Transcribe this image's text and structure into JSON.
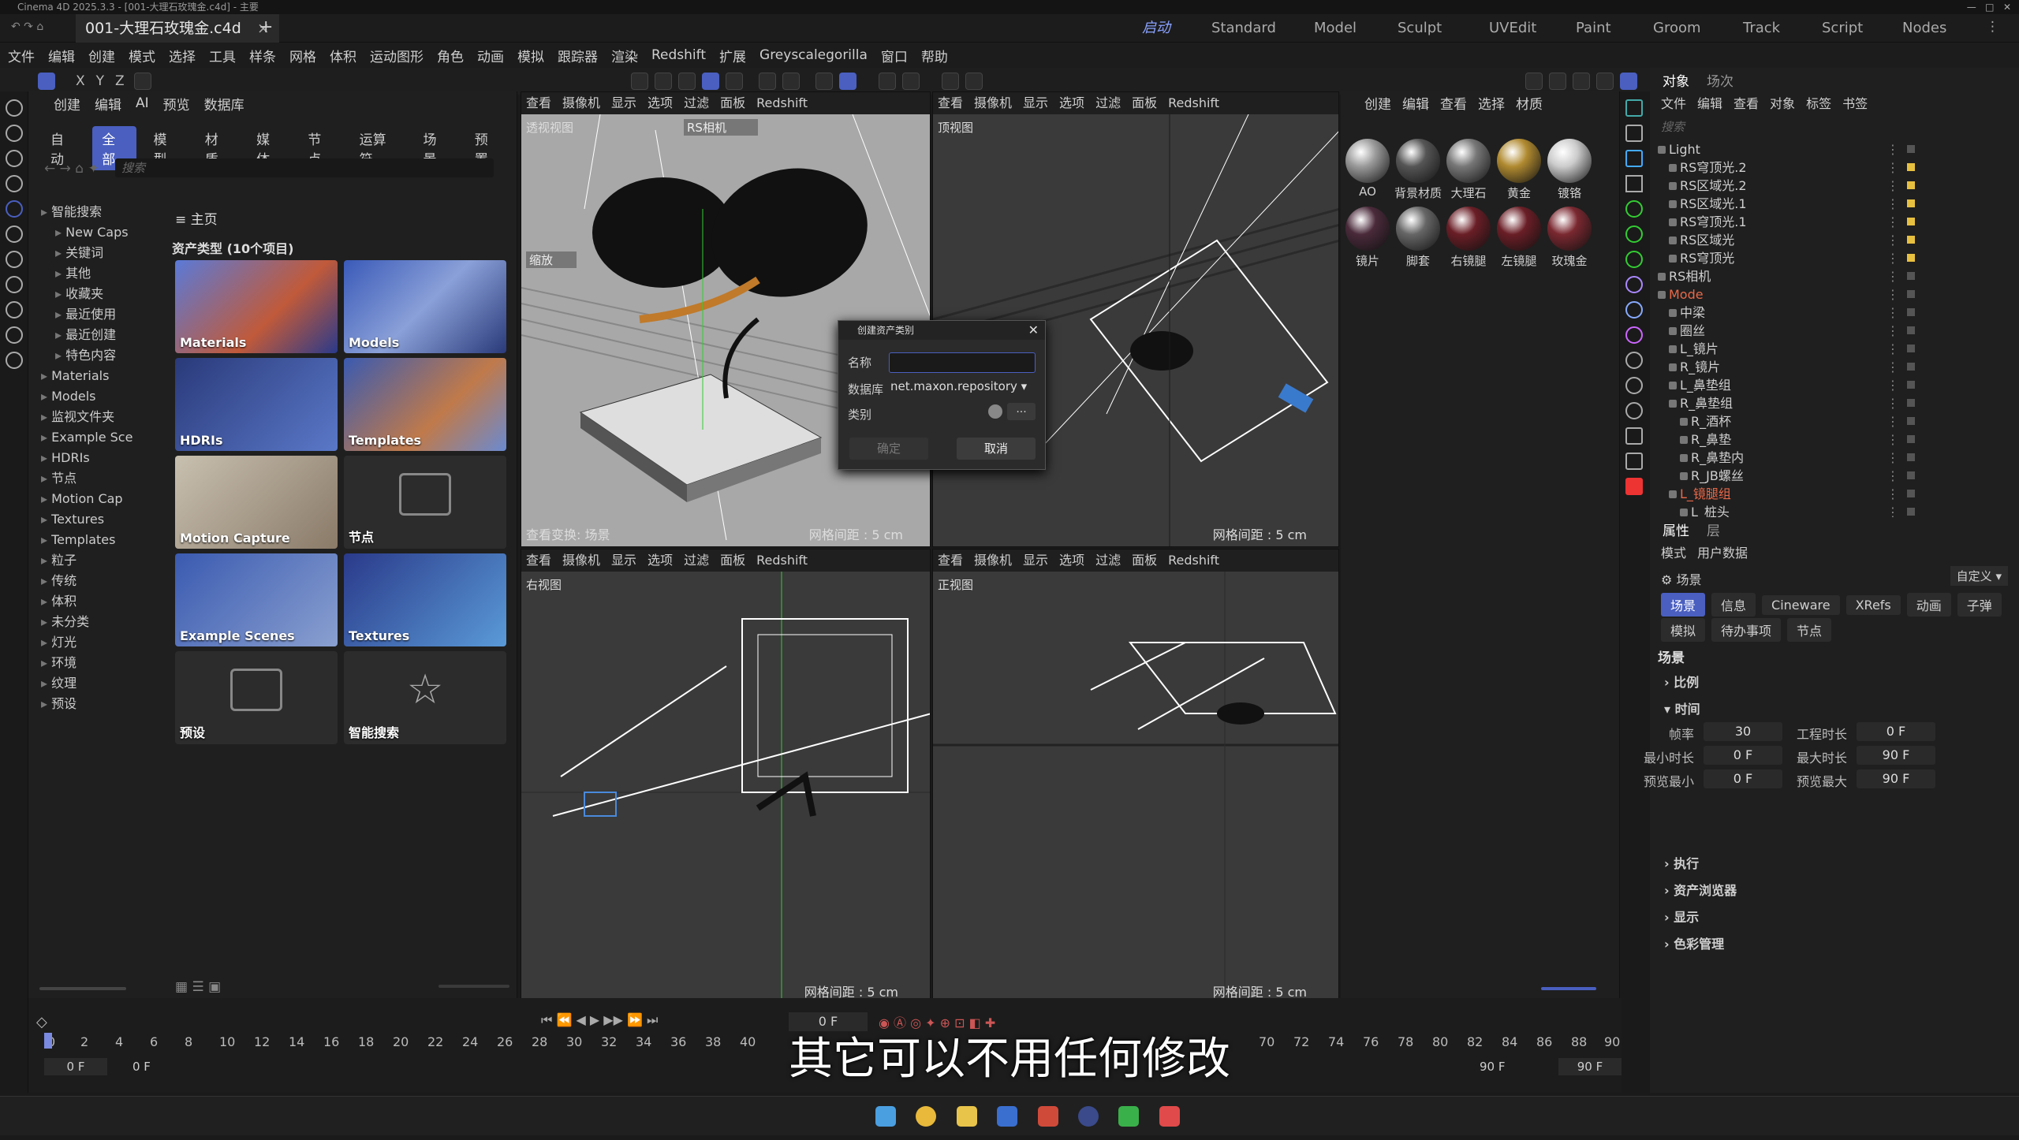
{
  "window": {
    "title": "Cinema 4D 2025.3.3 - [001-大理石玫瑰金.c4d] - 主要",
    "doc_tab": "001-大理石玫瑰金.c4d"
  },
  "layouts": [
    "启动",
    "Standard",
    "Model",
    "Sculpt",
    "UVEdit",
    "Paint",
    "Groom",
    "Track",
    "Script",
    "Nodes"
  ],
  "menu": [
    "文件",
    "编辑",
    "创建",
    "模式",
    "选择",
    "工具",
    "样条",
    "网格",
    "体积",
    "运动图形",
    "角色",
    "动画",
    "模拟",
    "跟踪器",
    "渲染",
    "Redshift",
    "扩展",
    "Greyscalegorilla",
    "窗口",
    "帮助"
  ],
  "axes": [
    "X",
    "Y",
    "Z"
  ],
  "assets": {
    "menu": [
      "创建",
      "编辑",
      "AI",
      "预览",
      "数据库"
    ],
    "tabs": [
      "自动",
      "全部",
      "模型",
      "材质",
      "媒体",
      "节点",
      "运算符",
      "场景",
      "预置"
    ],
    "search_placeholder": "搜索",
    "tree": [
      "智能搜索",
      "New Caps",
      "关键词",
      "其他",
      "收藏夹",
      "最近使用",
      "最近创建",
      "特色内容",
      "Materials",
      "Models",
      "监视文件夹",
      "Example Sce",
      "HDRIs",
      "节点",
      "Motion Cap",
      "Textures",
      "Templates",
      "粒子",
      "传统",
      "体积",
      "未分类",
      "灯光",
      "环境",
      "纹理",
      "预设"
    ],
    "home": "主页",
    "type_header": "资产类型 (10个项目)",
    "tiles": [
      "Materials",
      "Models",
      "HDRIs",
      "Templates",
      "Motion Capture",
      "节点",
      "Example Scenes",
      "Textures",
      "预设",
      "智能搜索"
    ]
  },
  "viewport_menu": [
    "查看",
    "摄像机",
    "显示",
    "选项",
    "过滤",
    "面板",
    "Redshift"
  ],
  "viewports": {
    "persp": {
      "name": "透视视图",
      "camera": "RS相机",
      "grid": "网格间距 : 5 cm",
      "transform": "查看变换: 场景",
      "zoom": "缩放"
    },
    "top": {
      "name": "顶视图",
      "grid": "网格间距 : 5 cm"
    },
    "right": {
      "name": "右视图",
      "grid": "网格间距 : 5 cm"
    },
    "front": {
      "name": "正视图",
      "grid": "网格间距 : 5 cm"
    }
  },
  "dialog": {
    "title": "创建资产类别",
    "name_label": "名称",
    "db_label": "数据库",
    "db_value": "net.maxon.repository",
    "cat_label": "类别",
    "ok": "确定",
    "cancel": "取消",
    "browse": "..."
  },
  "material": {
    "menu": [
      "创建",
      "编辑",
      "查看",
      "选择",
      "材质"
    ],
    "items": [
      {
        "name": "AO",
        "color": "#9a9a9a"
      },
      {
        "name": "背景材质",
        "color": "#555555"
      },
      {
        "name": "大理石",
        "color": "#777777"
      },
      {
        "name": "黄金",
        "color": "#b08a30"
      },
      {
        "name": "镀铬",
        "color": "#cccccc"
      },
      {
        "name": "镜片",
        "color": "#4a2a3a"
      },
      {
        "name": "脚套",
        "color": "#666666"
      },
      {
        "name": "右镜腿",
        "color": "#6a1e26"
      },
      {
        "name": "左镜腿",
        "color": "#6a1e26"
      },
      {
        "name": "玫瑰金",
        "color": "#7a2830"
      }
    ]
  },
  "objects": {
    "tabs": [
      "对象",
      "场次"
    ],
    "menu": [
      "文件",
      "编辑",
      "查看",
      "对象",
      "标签",
      "书签"
    ],
    "search_placeholder": "搜索",
    "items": [
      {
        "name": "Light",
        "indent": 0
      },
      {
        "name": "RS穹顶光.2",
        "indent": 1
      },
      {
        "name": "RS区域光.2",
        "indent": 1
      },
      {
        "name": "RS区域光.1",
        "indent": 1
      },
      {
        "name": "RS穹顶光.1",
        "indent": 1
      },
      {
        "name": "RS区域光",
        "indent": 1
      },
      {
        "name": "RS穹顶光",
        "indent": 1
      },
      {
        "name": "RS相机",
        "indent": 0
      },
      {
        "name": "Mode",
        "indent": 0
      },
      {
        "name": "中梁",
        "indent": 1
      },
      {
        "name": "圈丝",
        "indent": 1
      },
      {
        "name": "L_镜片",
        "indent": 1
      },
      {
        "name": "R_镜片",
        "indent": 1
      },
      {
        "name": "L_鼻垫组",
        "indent": 1
      },
      {
        "name": "R_鼻垫组",
        "indent": 1
      },
      {
        "name": "R_酒杯",
        "indent": 2
      },
      {
        "name": "R_鼻垫",
        "indent": 2
      },
      {
        "name": "R_鼻垫内",
        "indent": 2
      },
      {
        "name": "R_JB螺丝",
        "indent": 2
      },
      {
        "name": "L_镜腿组",
        "indent": 1
      },
      {
        "name": "L_桩头",
        "indent": 2
      }
    ]
  },
  "attributes": {
    "tabs": [
      "属性",
      "层"
    ],
    "menu": [
      "模式",
      "用户数据"
    ],
    "context": "场景",
    "preset": "自定义",
    "buttons_row1": [
      "场景",
      "信息",
      "Cineware",
      "XRefs",
      "动画",
      "子弹"
    ],
    "buttons_row2": [
      "模拟",
      "待办事项",
      "节点"
    ],
    "section": "场景",
    "groups": [
      "比例",
      "时间",
      "执行",
      "资产浏览器",
      "显示",
      "色彩管理"
    ],
    "fields": {
      "fps_label": "帧率",
      "fps": "30",
      "projlen_label": "工程时长",
      "projlen": "0 F",
      "min_label": "最小时长",
      "min": "0 F",
      "max_label": "最大时长",
      "max": "90 F",
      "pmin_label": "预览最小",
      "pmin": "0 F",
      "pmax_label": "预览最大",
      "pmax": "90 F"
    }
  },
  "timeline": {
    "current": "0 F",
    "ticks": [
      "0",
      "2",
      "4",
      "6",
      "8",
      "10",
      "12",
      "14",
      "16",
      "18",
      "20",
      "22",
      "24",
      "26",
      "28",
      "30",
      "32",
      "34",
      "36",
      "38",
      "40",
      "70",
      "72",
      "74",
      "76",
      "78",
      "80",
      "82",
      "84",
      "86",
      "88",
      "90"
    ],
    "start": "0 F",
    "start2": "0 F",
    "end": "90 F",
    "end2": "90 F"
  },
  "subtitle": "其它可以不用任何修改",
  "accent": "#4a5fc0"
}
